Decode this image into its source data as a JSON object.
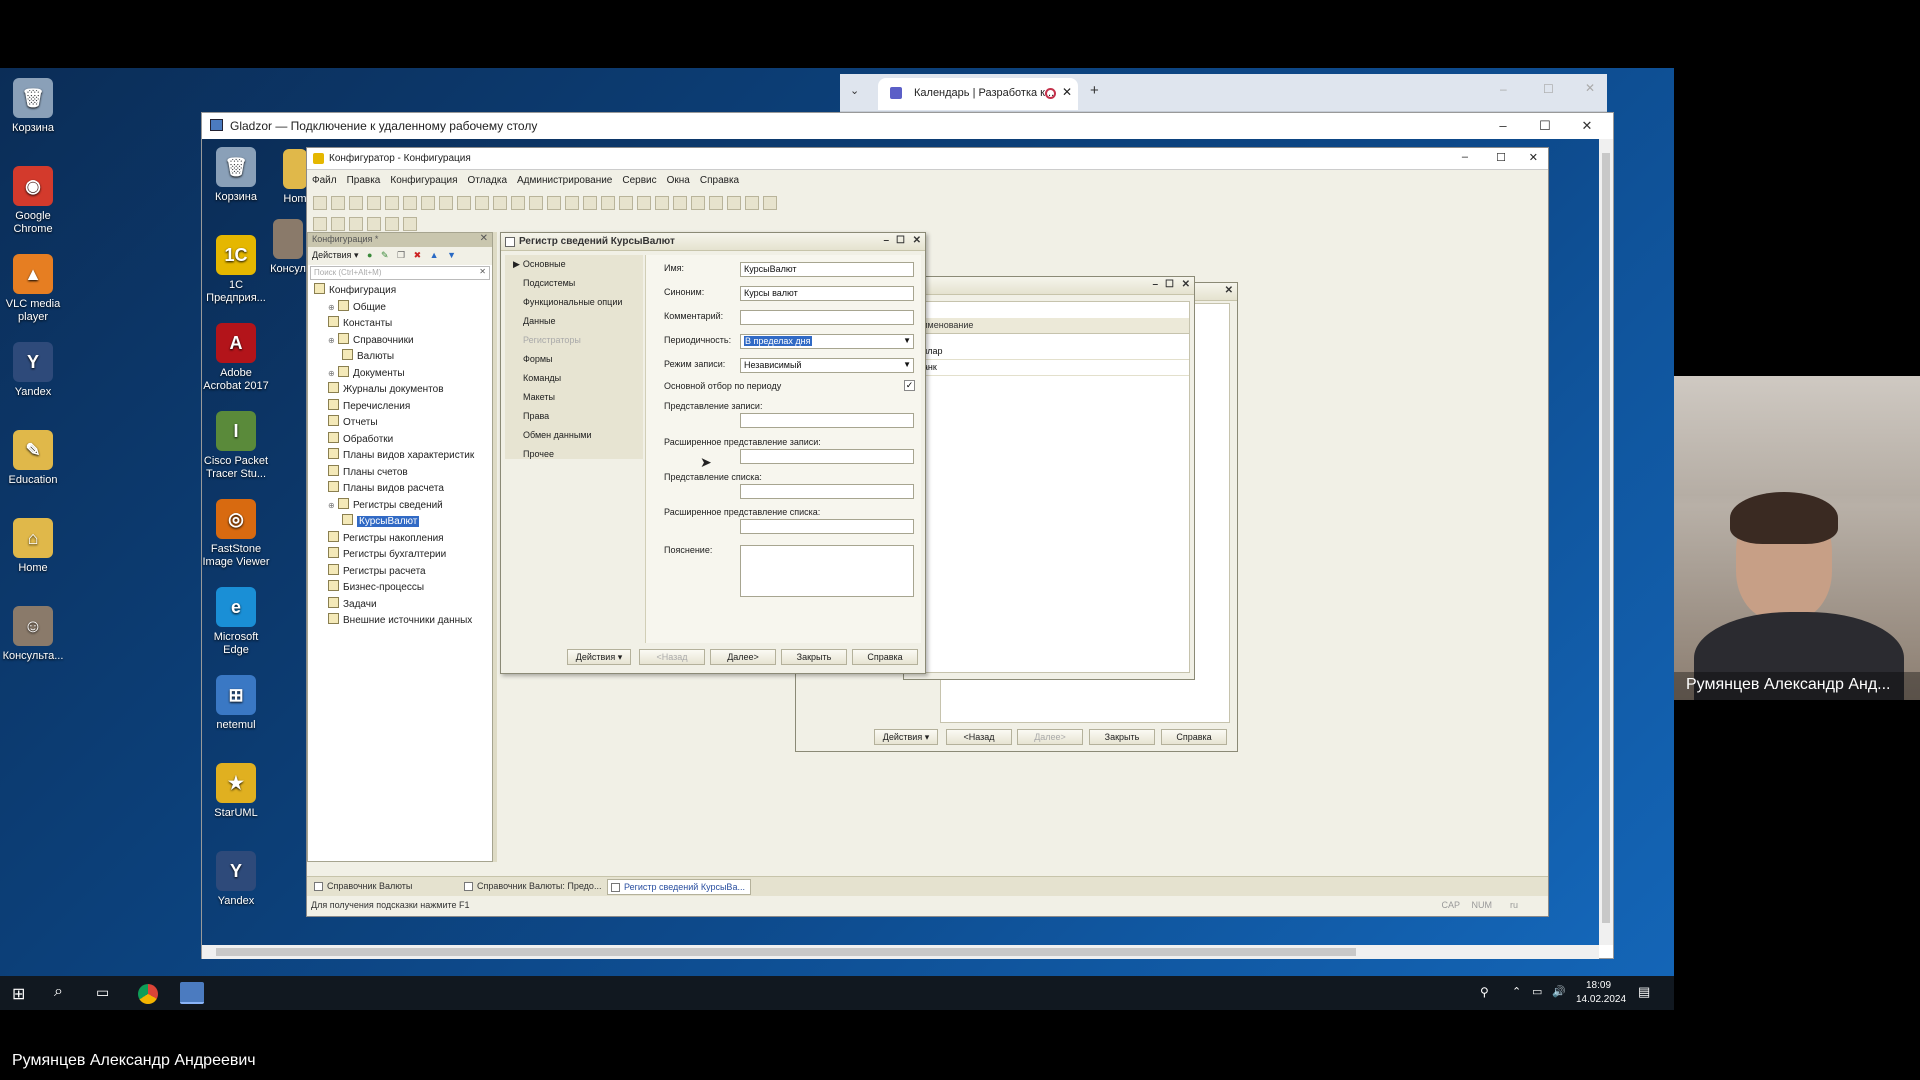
{
  "desktop_icons": [
    {
      "label": "Корзина",
      "color": "#8aa0b8",
      "glyph": "🗑"
    },
    {
      "label": "Google Chrome",
      "color": "#d33a2c",
      "glyph": "◉"
    },
    {
      "label": "VLC media player",
      "color": "#e67e22",
      "glyph": "▲"
    },
    {
      "label": "Yandex",
      "color": "#2e4a7a",
      "glyph": "Y"
    },
    {
      "label": "Education",
      "color": "#e0b84a",
      "glyph": "✎"
    },
    {
      "label": "Home",
      "color": "#e0b84a",
      "glyph": "⌂"
    },
    {
      "label": "Консульта...",
      "color": "#8a7a6a",
      "glyph": "☺"
    }
  ],
  "browser": {
    "tab_title": "Календарь | Разработка к..."
  },
  "rdp": {
    "title": "Gladzor — Подключение к удаленному рабочему столу",
    "desktop_icons": [
      {
        "label": "Корзина",
        "color": "#8aa0b8",
        "glyph": "🗑"
      },
      {
        "label": "1С Предприя...",
        "color": "#e5b700",
        "glyph": "1С"
      },
      {
        "label": "Adobe Acrobat 2017",
        "color": "#b3141a",
        "glyph": "A"
      },
      {
        "label": "Cisco Packet Tracer Stu...",
        "color": "#5a8a3a",
        "glyph": "I"
      },
      {
        "label": "FastStone Image Viewer",
        "color": "#d86a10",
        "glyph": "◎"
      },
      {
        "label": "Microsoft Edge",
        "color": "#1a8fd6",
        "glyph": "e"
      },
      {
        "label": "netemul",
        "color": "#3a78c4",
        "glyph": "⊞"
      },
      {
        "label": "StarUML",
        "color": "#e0b020",
        "glyph": "★"
      },
      {
        "label": "Yandex",
        "color": "#2e4a7a",
        "glyph": "Y"
      }
    ],
    "partial_icons": [
      "Hom",
      "Консул"
    ]
  },
  "configurator": {
    "title": "Конфигуратор - Конфигурация",
    "menu": [
      "Файл",
      "Правка",
      "Конфигурация",
      "Отладка",
      "Администрирование",
      "Сервис",
      "Окна",
      "Справка"
    ],
    "tree_panel_title": "Конфигурация *",
    "tree_actions_label": "Действия",
    "search_placeholder": "Поиск (Ctrl+Alt+M)",
    "tree": [
      {
        "label": "Конфигурация",
        "indent": 0
      },
      {
        "label": "Общие",
        "indent": 1
      },
      {
        "label": "Константы",
        "indent": 1
      },
      {
        "label": "Справочники",
        "indent": 1
      },
      {
        "label": "Валюты",
        "indent": 2
      },
      {
        "label": "Документы",
        "indent": 1
      },
      {
        "label": "Журналы документов",
        "indent": 1
      },
      {
        "label": "Перечисления",
        "indent": 1
      },
      {
        "label": "Отчеты",
        "indent": 1
      },
      {
        "label": "Обработки",
        "indent": 1
      },
      {
        "label": "Планы видов характеристик",
        "indent": 1
      },
      {
        "label": "Планы счетов",
        "indent": 1
      },
      {
        "label": "Планы видов расчета",
        "indent": 1
      },
      {
        "label": "Регистры сведений",
        "indent": 1
      },
      {
        "label": "КурсыВалют",
        "indent": 2,
        "selected": true
      },
      {
        "label": "Регистры накопления",
        "indent": 1
      },
      {
        "label": "Регистры бухгалтерии",
        "indent": 1
      },
      {
        "label": "Регистры расчета",
        "indent": 1
      },
      {
        "label": "Бизнес-процессы",
        "indent": 1
      },
      {
        "label": "Задачи",
        "indent": 1
      },
      {
        "label": "Внешние источники данных",
        "indent": 1
      }
    ],
    "window_tabs": [
      "Справочник Валюты",
      "Справочник Валюты: Предо...",
      "Регистр сведений КурсыВа..."
    ],
    "status_hint": "Для получения подсказки нажмите F1",
    "status_indicators": [
      "CAP",
      "NUM",
      "ru"
    ]
  },
  "register_dialog": {
    "title": "Регистр сведений КурсыВалют",
    "nav": [
      "Основные",
      "Подсистемы",
      "Функциональные опции",
      "Данные",
      "Регистраторы",
      "Формы",
      "Команды",
      "Макеты",
      "Права",
      "Обмен данными",
      "Прочее"
    ],
    "fields": {
      "name_label": "Имя:",
      "name_value": "КурсыВалют",
      "synonym_label": "Синоним:",
      "synonym_value": "Курсы валют",
      "comment_label": "Комментарий:",
      "comment_value": "",
      "periodicity_label": "Периодичность:",
      "periodicity_value": "В пределах дня",
      "write_mode_label": "Режим записи:",
      "write_mode_value": "Независимый",
      "period_filter_label": "Основной отбор по периоду",
      "record_repr_label": "Представление записи:",
      "ext_record_repr_label": "Расширенное представление записи:",
      "list_repr_label": "Представление списка:",
      "ext_list_repr_label": "Расширенное представление списка:",
      "explanation_label": "Пояснение:"
    },
    "buttons": {
      "actions": "Действия",
      "back": "<Назад",
      "next": "Далее>",
      "close": "Закрыть",
      "help": "Справка"
    }
  },
  "back_dialog": {
    "column_header": "Наименование",
    "rows": [
      "Доллар",
      "Франк"
    ],
    "buttons": {
      "actions": "Действия",
      "back": "<Назад",
      "next": "Далее>",
      "close": "Закрыть",
      "help": "Справка"
    }
  },
  "taskbar": {
    "time": "18:09",
    "date": "14.02.2024"
  },
  "webcam": {
    "name": "Румянцев Александр Анд..."
  },
  "caption": {
    "name": "Румянцев Александр Андреевич"
  }
}
